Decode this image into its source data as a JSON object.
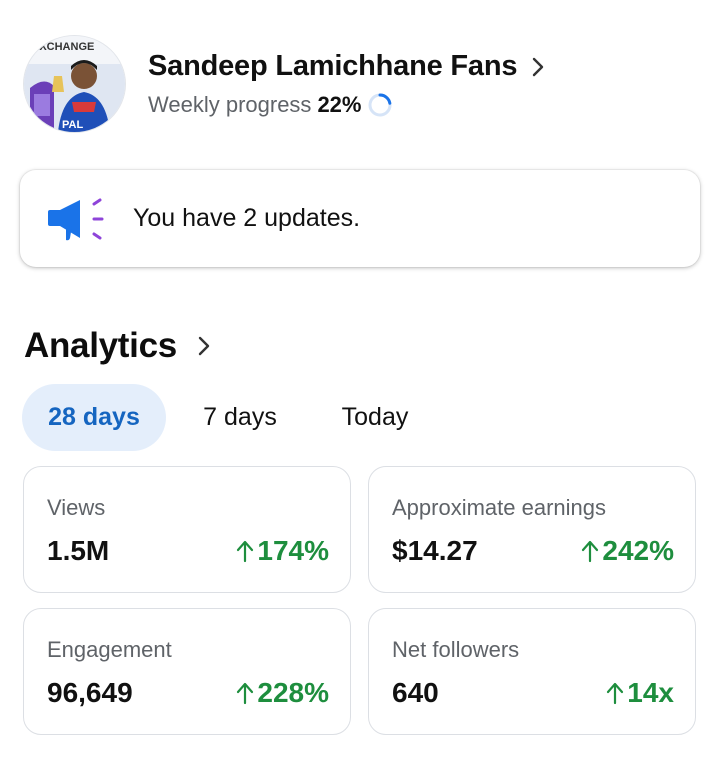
{
  "page": {
    "name": "Sandeep Lamichhane Fans",
    "avatar_badge_text": "EXCHANGE",
    "avatar_country_text": "PAL",
    "progress_label": "Weekly progress",
    "progress_value": "22%",
    "progress_fraction": 0.22
  },
  "updates": {
    "text": "You have 2 updates."
  },
  "analytics": {
    "title": "Analytics",
    "tabs": [
      {
        "label": "28 days",
        "active": true
      },
      {
        "label": "7 days",
        "active": false
      },
      {
        "label": "Today",
        "active": false
      }
    ],
    "cards": [
      {
        "label": "Views",
        "value": "1.5M",
        "change": "174%"
      },
      {
        "label": "Approximate earnings",
        "value": "$14.27",
        "change": "242%"
      },
      {
        "label": "Engagement",
        "value": "96,649",
        "change": "228%"
      },
      {
        "label": "Net followers",
        "value": "640",
        "change": "14x"
      }
    ]
  },
  "colors": {
    "accent_blue": "#1565c0",
    "active_tab_bg": "#e4eefb",
    "positive_green": "#1e8e3e",
    "secondary_text": "#5f6368"
  },
  "icons": {
    "chevron": "chevron-right-icon",
    "progress": "progress-ring-icon",
    "updates": "megaphone-icon",
    "trend": "arrow-up-icon"
  }
}
